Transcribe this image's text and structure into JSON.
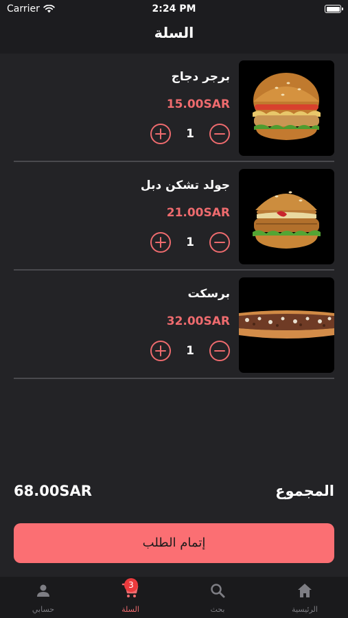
{
  "status_bar": {
    "carrier": "Carrier",
    "time": "2:24 PM"
  },
  "nav": {
    "title": "السلة"
  },
  "cart": {
    "items": [
      {
        "name": "برجر دجاج",
        "price": "15.00SAR",
        "quantity": "1",
        "image": "chicken-burger"
      },
      {
        "name": "جولد تشكن دبل",
        "price": "21.00SAR",
        "quantity": "1",
        "image": "double-chicken-burger"
      },
      {
        "name": "برسكت",
        "price": "32.00SAR",
        "quantity": "1",
        "image": "brisket-sandwich"
      }
    ],
    "total_label": "المجموع",
    "total_value": "68.00SAR",
    "checkout_label": "إتمام الطلب"
  },
  "tabs": [
    {
      "label": "الرئيسية",
      "icon": "home-icon",
      "active": false
    },
    {
      "label": "بحث",
      "icon": "search-icon",
      "active": false
    },
    {
      "label": "السلة",
      "icon": "cart-icon",
      "active": true,
      "badge": "3"
    },
    {
      "label": "حسابي",
      "icon": "person-icon",
      "active": false
    }
  ],
  "colors": {
    "accent": "#ee6b6e",
    "button": "#fb6f73",
    "background": "#232326",
    "bar": "#1c1c1f"
  }
}
